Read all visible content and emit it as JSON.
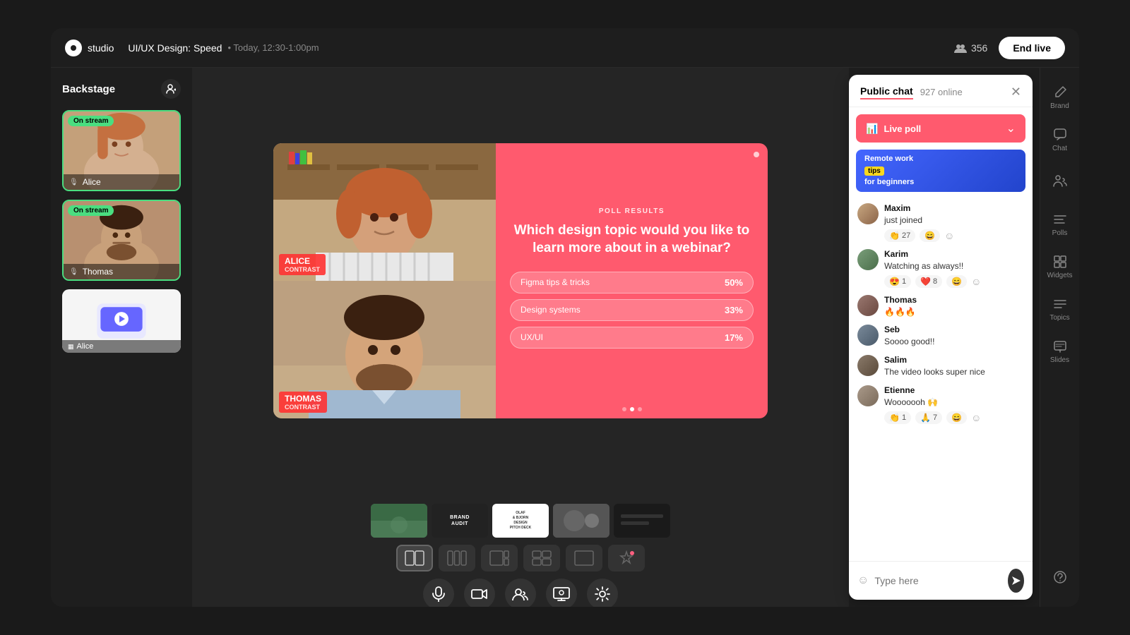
{
  "app": {
    "logo_text": "studio",
    "event_title": "UI/UX Design: Speed",
    "event_time": "Today, 12:30-1:00pm",
    "viewer_count": "356",
    "end_live_label": "End live"
  },
  "backstage": {
    "title": "Backstage",
    "participants": [
      {
        "name": "Alice",
        "on_stream": true,
        "has_mic": true
      },
      {
        "name": "Thomas",
        "on_stream": true,
        "has_mic": true
      }
    ],
    "slide_name": "Alice"
  },
  "stream": {
    "alice_name": "ALICE",
    "alice_brand": "CONTRAST",
    "thomas_name": "THOMAS",
    "thomas_brand": "CONTRAST",
    "poll": {
      "label": "POLL RESULTS",
      "question": "Which design topic would you like to learn more about in a webinar?",
      "options": [
        {
          "text": "Figma tips & tricks",
          "pct": "50%"
        },
        {
          "text": "Design systems",
          "pct": "33%"
        },
        {
          "text": "UX/UI",
          "pct": "17%"
        }
      ]
    }
  },
  "slides": [
    {
      "id": 1,
      "type": "photo"
    },
    {
      "id": 2,
      "label": "BRAND\nAUDIT"
    },
    {
      "id": 3,
      "label": "OLAF\n& BJORN\nDESIGN\nPITCH DECK"
    },
    {
      "id": 4,
      "type": "photo2"
    },
    {
      "id": 5,
      "type": "dark"
    }
  ],
  "layouts": [
    {
      "id": "two-col",
      "active": true
    },
    {
      "id": "three-col",
      "active": false
    },
    {
      "id": "one-right",
      "active": false
    },
    {
      "id": "four",
      "active": false
    },
    {
      "id": "single",
      "active": false
    },
    {
      "id": "ai",
      "active": false
    }
  ],
  "controls": [
    {
      "id": "mic",
      "icon": "🎙"
    },
    {
      "id": "camera",
      "icon": "📹"
    },
    {
      "id": "people",
      "icon": "👥"
    },
    {
      "id": "screen",
      "icon": "🖥"
    },
    {
      "id": "settings",
      "icon": "⚙"
    }
  ],
  "right_panel": [
    {
      "id": "edit",
      "icon": "✏",
      "label": "Brand"
    },
    {
      "id": "chat-bubble",
      "icon": "💬",
      "label": "Chat"
    },
    {
      "id": "people-list",
      "icon": "👥",
      "label": ""
    },
    {
      "id": "polls",
      "icon": "≡",
      "label": "Polls"
    },
    {
      "id": "widgets",
      "icon": "▦",
      "label": "Widgets"
    },
    {
      "id": "topics",
      "icon": "≡",
      "label": "Topics"
    },
    {
      "id": "slides",
      "icon": "▤",
      "label": "Slides"
    },
    {
      "id": "help",
      "icon": "?",
      "label": ""
    }
  ],
  "chat": {
    "tab_label": "Public chat",
    "online_count": "927 online",
    "live_poll_label": "Live poll",
    "widget_text_line1": "Remote work",
    "widget_text_highlight": "tips",
    "widget_text_line2": "for beginners",
    "messages": [
      {
        "name": "Maxim",
        "text": "just joined",
        "reactions": [
          {
            "emoji": "👏",
            "count": "27"
          },
          {
            "emoji": "😄",
            "count": ""
          }
        ]
      },
      {
        "name": "Karim",
        "text": "Watching as always!!",
        "reactions": [
          {
            "emoji": "😍",
            "count": "1"
          },
          {
            "emoji": "❤️",
            "count": "8"
          },
          {
            "emoji": "😄",
            "count": ""
          }
        ]
      },
      {
        "name": "Thomas",
        "text": "🔥🔥🔥",
        "reactions": []
      },
      {
        "name": "Seb",
        "text": "Soooo good!!",
        "reactions": []
      },
      {
        "name": "Salim",
        "text": "The video looks super nice",
        "reactions": []
      },
      {
        "name": "Etienne",
        "text": "Wooooooh 🙌",
        "reactions": [
          {
            "emoji": "👏",
            "count": "1"
          },
          {
            "emoji": "🙏",
            "count": "7"
          },
          {
            "emoji": "😄",
            "count": ""
          }
        ]
      }
    ],
    "input_placeholder": "Type here"
  }
}
